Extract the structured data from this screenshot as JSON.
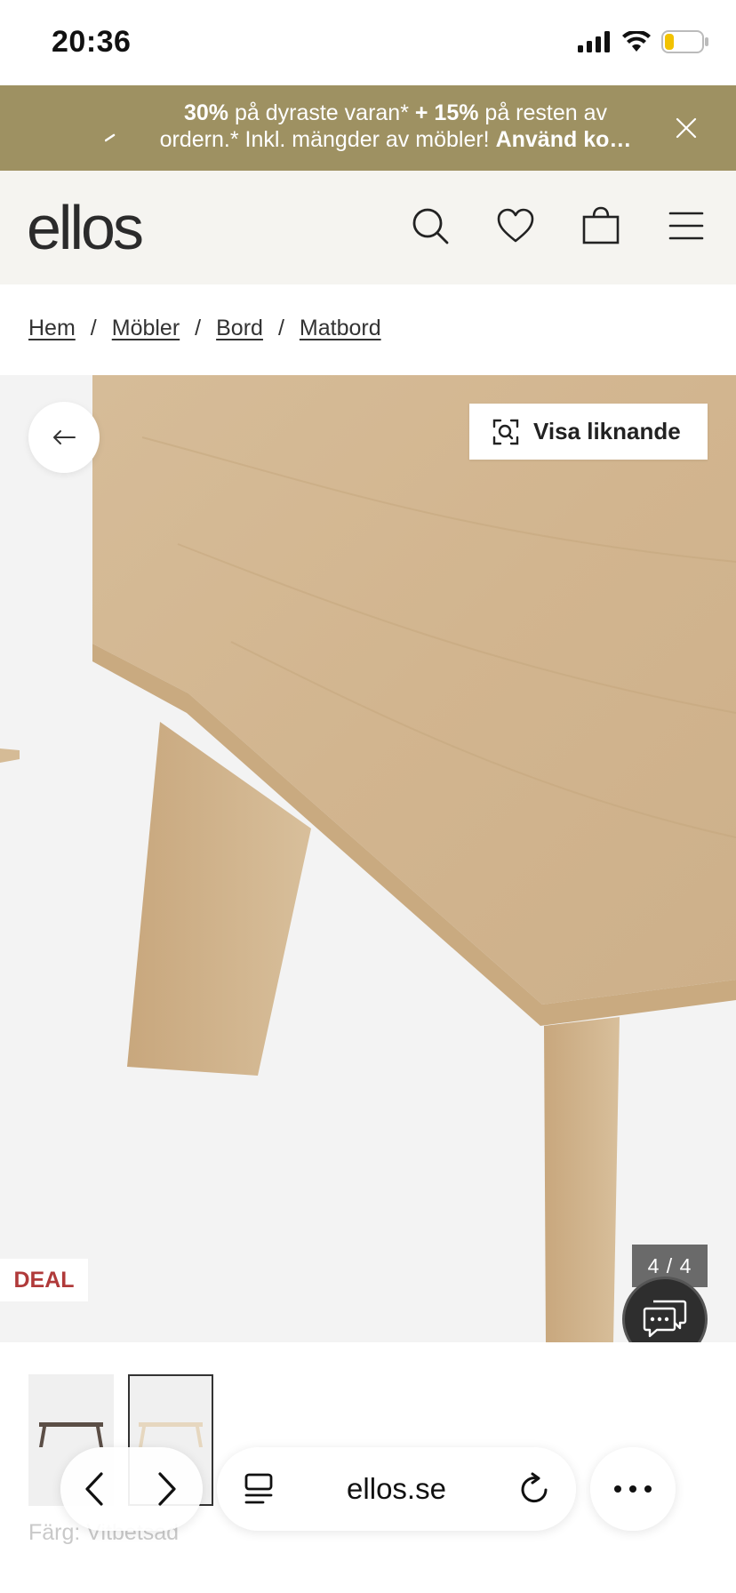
{
  "status_bar": {
    "time": "20:36"
  },
  "promo": {
    "line1_bold1": "30%",
    "line1_mid": " på dyraste varan* ",
    "line1_bold2": "+ 15%",
    "line1_end": " på resten av",
    "line2_start": "ordern.* Inkl. mängder av möbler! ",
    "line2_bold": "Använd ko…",
    "bg_color": "#9e9162"
  },
  "header": {
    "logo": "ellos",
    "icons": [
      "search-icon",
      "heart-icon",
      "bag-icon",
      "menu-icon"
    ]
  },
  "breadcrumb": {
    "items": [
      "Hem",
      "Möbler",
      "Bord",
      "Matbord"
    ],
    "separator": "/"
  },
  "product": {
    "similar_label": "Visa liknande",
    "deal_label": "DEAL",
    "image_counter": "4 / 4",
    "deal_color": "#b03a3a"
  },
  "variants": {
    "color_label": "Färg: Vitbetsad",
    "selected_index": 1
  },
  "browser": {
    "url": "ellos.se"
  }
}
